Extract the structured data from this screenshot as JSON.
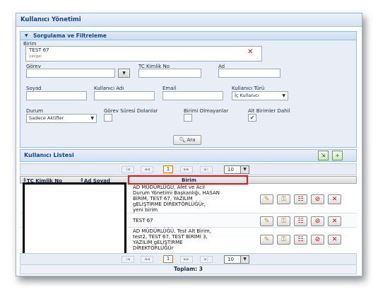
{
  "window": {
    "title": "Kullanıcı Yönetimi"
  },
  "filter": {
    "section_title": "Sorgulama ve Filtreleme",
    "birim": {
      "label": "Birim",
      "value": "TEST 67",
      "sub": "yazgel"
    },
    "gorev": {
      "label": "Görev",
      "value": ""
    },
    "tc": {
      "label": "TC Kimlik No",
      "value": ""
    },
    "ad": {
      "label": "Ad",
      "value": ""
    },
    "soyad": {
      "label": "Soyad",
      "value": ""
    },
    "kullanici_adi": {
      "label": "Kullanıcı Adı",
      "value": ""
    },
    "email": {
      "label": "Email",
      "value": ""
    },
    "kullanici_turu": {
      "label": "Kullanıcı Türü",
      "value": "İç Kullanıcı"
    },
    "durum": {
      "label": "Durum",
      "value": "Sadece Aktifler"
    },
    "checks": {
      "gorev_suresi": {
        "label": "Görev Süresi Dolanlar",
        "checked": false
      },
      "birim_olmayanlar": {
        "label": "Birimi Olmayanlar",
        "checked": false
      },
      "alt_birimler": {
        "label": "Alt Birimler Dahil",
        "checked": true
      }
    },
    "search_button": "Ara"
  },
  "list": {
    "title": "Kullanıcı Listesi",
    "columns": {
      "tc": "TC Kimlik No",
      "ad_soyad": "Ad Soyad",
      "birim": "Birim"
    },
    "pager": {
      "page": "1",
      "page_size": "10"
    },
    "rows": [
      {
        "birim": [
          "AD MÜDÜRLÜĞÜ, Afet ve Acil",
          "Durum Yönetimi Başkanlığı, HASAN",
          "BİRİM, TEST 67, YAZILIM",
          "gELİŞTİRME DİREKTÖRLÜĞÜr,",
          "yeni birim"
        ]
      },
      {
        "birim": [
          "TEST 67"
        ]
      },
      {
        "birim": [
          "AD MÜDÜRLÜĞÜ, Test Alt Birim,",
          "test2, TEST 67, TEST BİRİMİ 3,",
          "YAZILIM gELİŞTİRME",
          "DİREKTÖRLÜĞÜr"
        ]
      }
    ],
    "total": "Toplam: 3"
  }
}
